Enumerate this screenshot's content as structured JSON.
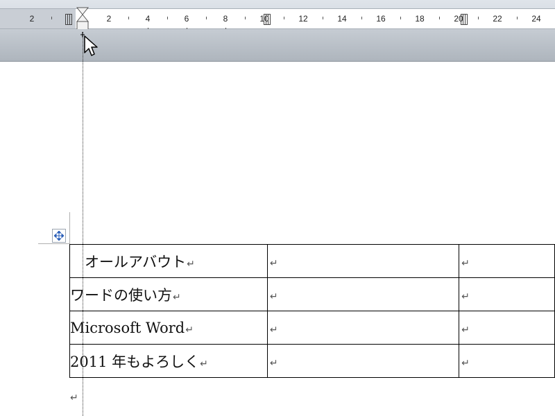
{
  "ruler": {
    "labels": [
      "2",
      "2",
      "4",
      "6",
      "8",
      "10",
      "12",
      "14",
      "16",
      "18",
      "20",
      "22",
      "24"
    ]
  },
  "table": {
    "rows": [
      {
        "col1": "　オールアバウト",
        "col2": "",
        "col3": ""
      },
      {
        "col1": "ワードの使い方",
        "col2": "",
        "col3": ""
      },
      {
        "col1": "Microsoft Word",
        "col2": "",
        "col3": ""
      },
      {
        "col1": "2011 年もよろしく",
        "col2": "",
        "col3": ""
      }
    ]
  },
  "icons": {
    "paragraph_mark": "↵",
    "move_handle": "four-arrow-move-icon",
    "pointer": "arrow-cursor-icon",
    "indent_marker": "hourglass-indent-icon"
  },
  "colors": {
    "ruler_background": "#dfe4ea",
    "ruler_shadow": "#aeb5bd",
    "move_handle_arrows": "#2b5fb8"
  }
}
